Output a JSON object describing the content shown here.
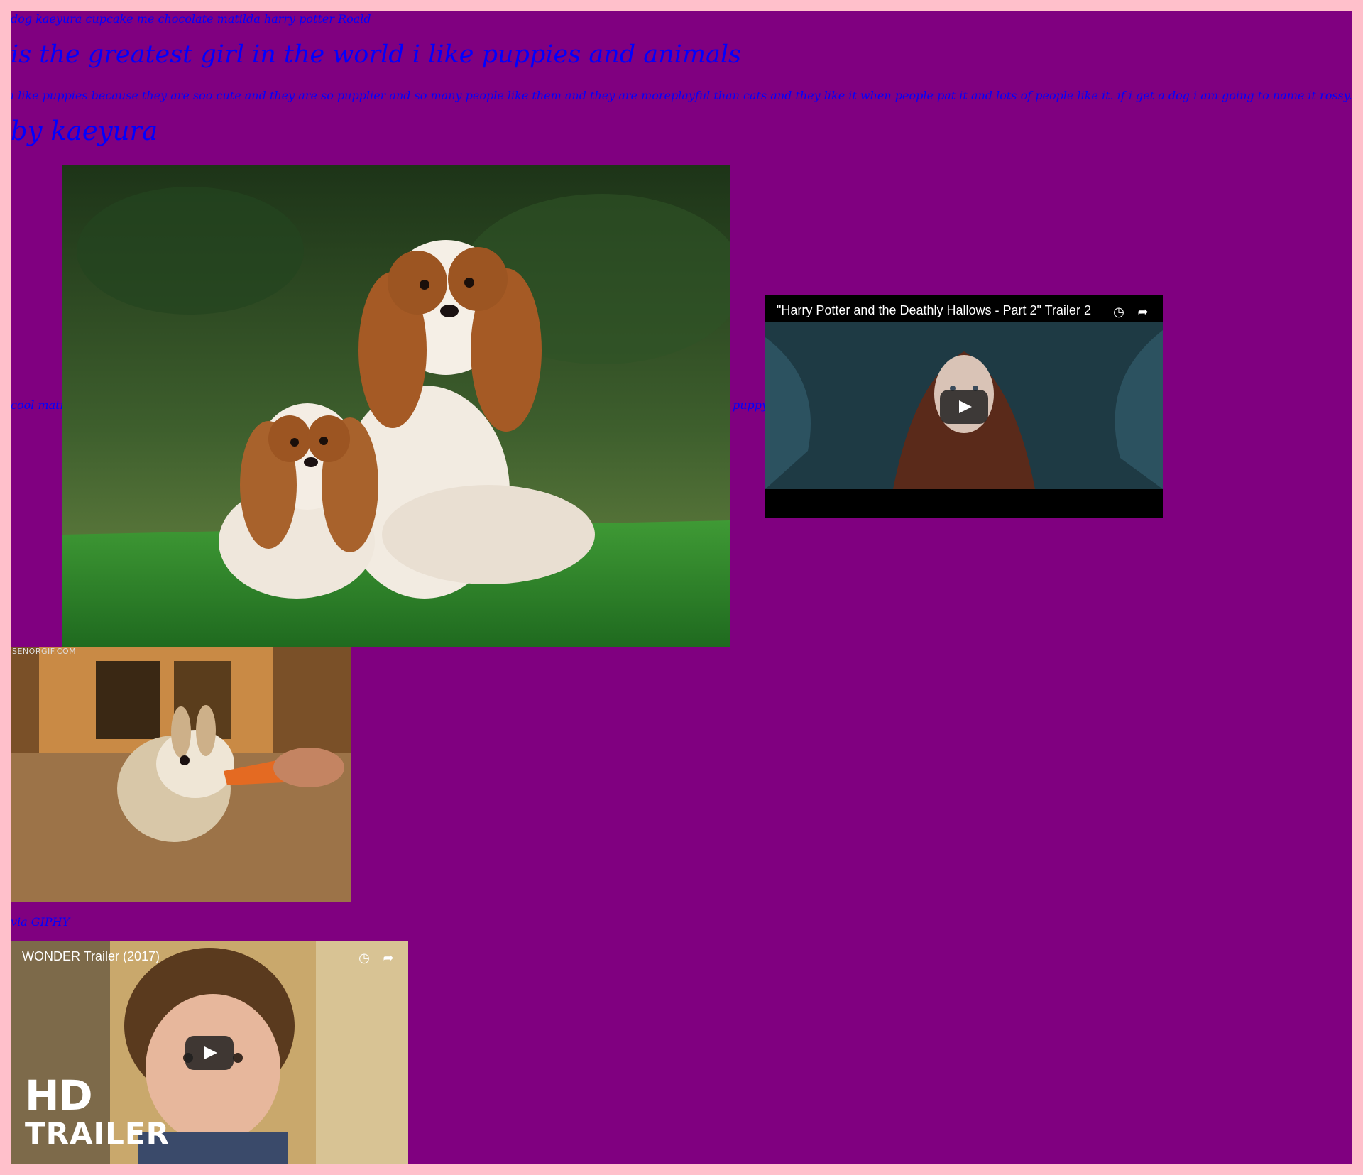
{
  "header": {
    "topline": "dog kaeyura cupcake me chocolate matilda harry potter Roald",
    "headline": "is the greatest girl in the world i like puppies and animals",
    "paragraph": "i like puppies because they are soo cute and they are so pupplier and so many people like them and they are moreplayful than cats and they like it when people pat it and lots of people like it.  if i get a dog i am going to name it rossy.",
    "byline": "by kaeyura"
  },
  "links": {
    "cool_matilts": "cool matilts",
    "puppy": "puppy",
    "via_giphy": "via GIPHY"
  },
  "images": {
    "bunny_watermark": "SENORGIF.COM"
  },
  "videos": [
    {
      "title": "\"Harry Potter and the Deathly Hallows - Part 2\" Trailer 2",
      "icons": [
        "clock-icon",
        "share-icon"
      ]
    },
    {
      "title": "WONDER Trailer (2017)",
      "overlay_line1": "HD",
      "overlay_line2": "TRAILER",
      "icons": [
        "clock-icon",
        "share-icon"
      ]
    }
  ],
  "colors": {
    "page_bg": "#ffc0cb",
    "content_bg": "#800080",
    "text": "#0000ff"
  }
}
